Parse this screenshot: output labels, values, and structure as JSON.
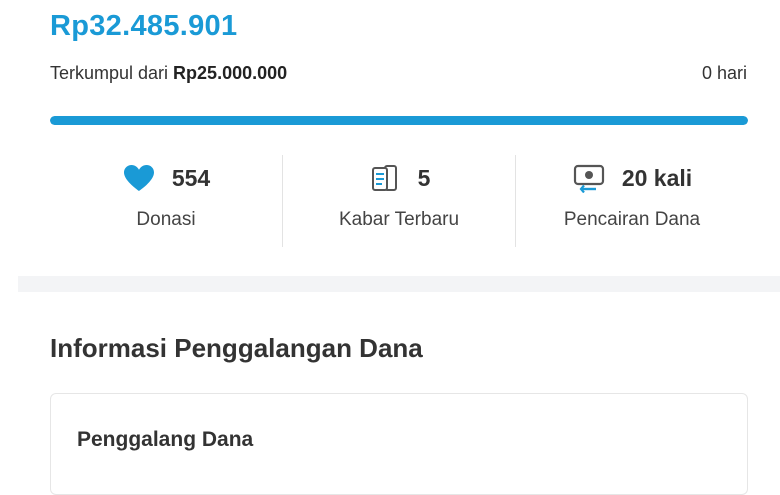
{
  "campaign": {
    "amount_collected": "Rp32.485.901",
    "collected_prefix": "Terkumpul dari ",
    "target": "Rp25.000.000",
    "days_left": "0 hari",
    "progress_percent": 100
  },
  "stats": [
    {
      "icon": "heart-icon",
      "value": "554",
      "label": "Donasi",
      "color": "#1a9ad6"
    },
    {
      "icon": "news-icon",
      "value": "5",
      "label": "Kabar Terbaru"
    },
    {
      "icon": "withdrawal-icon",
      "value": "20 kali",
      "label": "Pencairan Dana"
    }
  ],
  "info_section": {
    "title": "Informasi Penggalangan Dana",
    "card_title": "Penggalang Dana"
  }
}
